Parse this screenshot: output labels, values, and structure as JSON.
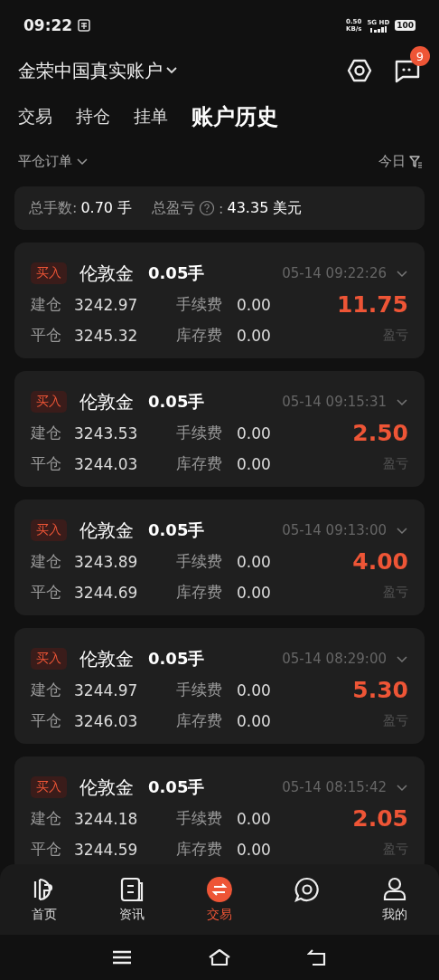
{
  "status_bar": {
    "time": "09:22",
    "speed": "0.50",
    "speed_unit": "KB/s",
    "network": "5G HD",
    "battery": "100"
  },
  "header": {
    "account": "金荣中国真实账户",
    "message_badge": "9"
  },
  "tabs": [
    {
      "label": "交易",
      "selected": false
    },
    {
      "label": "持仓",
      "selected": false
    },
    {
      "label": "挂单",
      "selected": false
    },
    {
      "label": "账户历史",
      "selected": true
    }
  ],
  "filter": {
    "order_type": "平仓订单",
    "period": "今日"
  },
  "summary": {
    "lots_label": "总手数:",
    "lots": "0.70 手",
    "pnl_label": "总盈亏",
    "pnl_colon": ":",
    "pnl": "43.35 美元"
  },
  "orders": [
    {
      "side": "买入",
      "symbol": "伦敦金",
      "lots": "0.05手",
      "time": "05-14 09:22:26",
      "open_label": "建仓",
      "open": "3242.97",
      "close_label": "平仓",
      "close": "3245.32",
      "fee_label": "手续费",
      "fee": "0.00",
      "swap_label": "库存费",
      "swap": "0.00",
      "profit": "11.75",
      "profit_label": "盈亏"
    },
    {
      "side": "买入",
      "symbol": "伦敦金",
      "lots": "0.05手",
      "time": "05-14 09:15:31",
      "open_label": "建仓",
      "open": "3243.53",
      "close_label": "平仓",
      "close": "3244.03",
      "fee_label": "手续费",
      "fee": "0.00",
      "swap_label": "库存费",
      "swap": "0.00",
      "profit": "2.50",
      "profit_label": "盈亏"
    },
    {
      "side": "买入",
      "symbol": "伦敦金",
      "lots": "0.05手",
      "time": "05-14 09:13:00",
      "open_label": "建仓",
      "open": "3243.89",
      "close_label": "平仓",
      "close": "3244.69",
      "fee_label": "手续费",
      "fee": "0.00",
      "swap_label": "库存费",
      "swap": "0.00",
      "profit": "4.00",
      "profit_label": "盈亏"
    },
    {
      "side": "买入",
      "symbol": "伦敦金",
      "lots": "0.05手",
      "time": "05-14 08:29:00",
      "open_label": "建仓",
      "open": "3244.97",
      "close_label": "平仓",
      "close": "3246.03",
      "fee_label": "手续费",
      "fee": "0.00",
      "swap_label": "库存费",
      "swap": "0.00",
      "profit": "5.30",
      "profit_label": "盈亏"
    },
    {
      "side": "买入",
      "symbol": "伦敦金",
      "lots": "0.05手",
      "time": "05-14 08:15:42",
      "open_label": "建仓",
      "open": "3244.18",
      "close_label": "平仓",
      "close": "3244.59",
      "fee_label": "手续费",
      "fee": "0.00",
      "swap_label": "库存费",
      "swap": "0.00",
      "profit": "2.05",
      "profit_label": "盈亏"
    }
  ],
  "bottom_nav": [
    {
      "kind": "home",
      "label": "首页",
      "selected": false
    },
    {
      "kind": "news",
      "label": "资讯",
      "selected": false
    },
    {
      "kind": "trade",
      "label": "交易",
      "selected": true
    },
    {
      "kind": "community",
      "selected": false
    },
    {
      "kind": "me",
      "label": "我的",
      "selected": false
    }
  ]
}
